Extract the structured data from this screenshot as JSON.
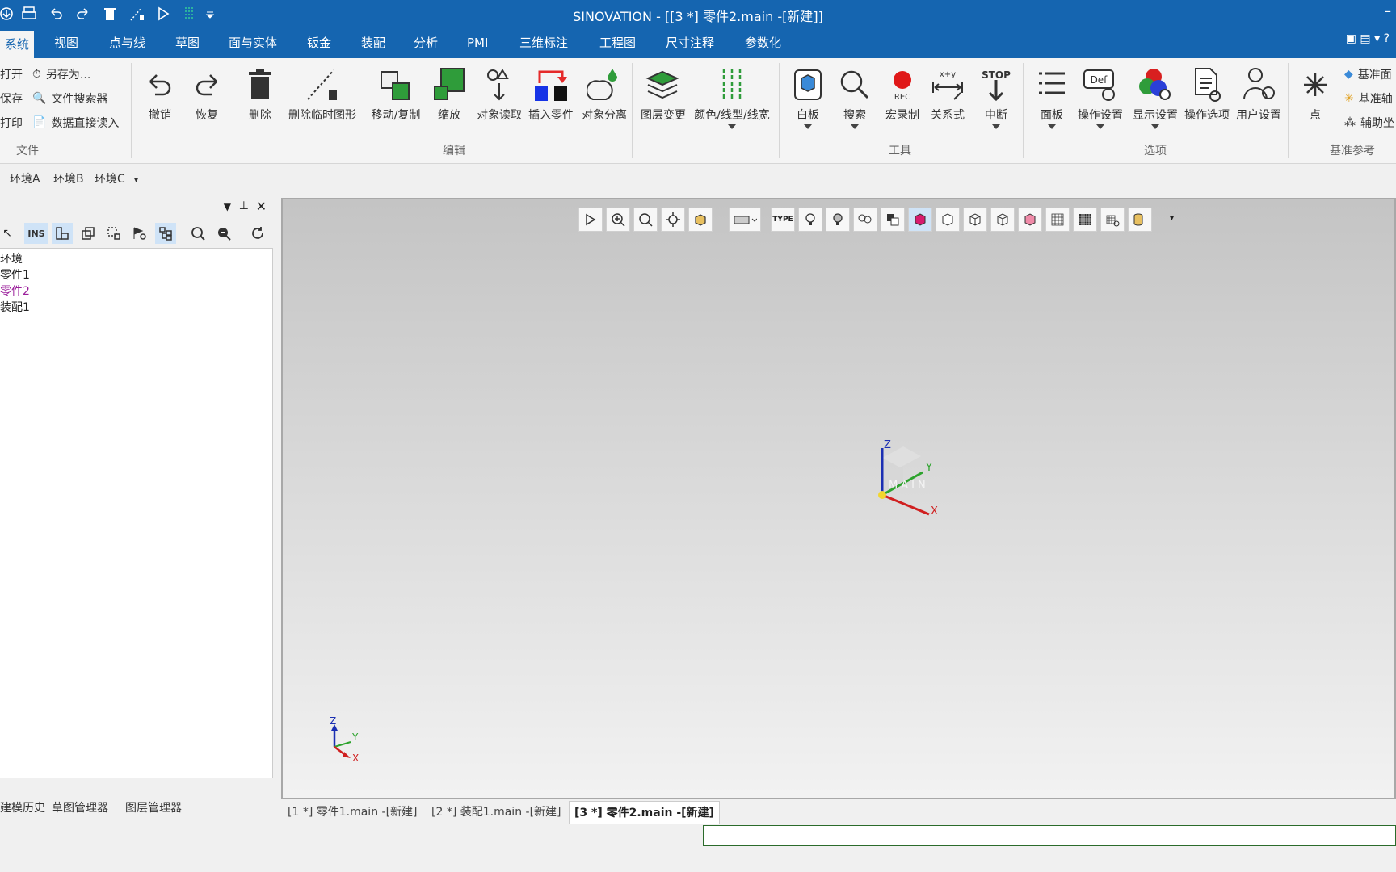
{
  "window": {
    "title": "SINOVATION - [[3 *] 零件2.main -[新建]]"
  },
  "menu": [
    "系统",
    "视图",
    "点与线",
    "草图",
    "面与实体",
    "钣金",
    "装配",
    "分析",
    "PMI",
    "三维标注",
    "工程图",
    "尺寸注释",
    "参数化"
  ],
  "file_group": {
    "open": "打开",
    "save_as": "另存为...",
    "save": "保存",
    "file_search": "文件搜索器",
    "print": "打印",
    "data_import": "数据直接读入",
    "label": "文件"
  },
  "edit_group": {
    "undo": "撤销",
    "redo": "恢复",
    "delete": "删除",
    "delete_temp": "删除临时图形",
    "move_copy": "移动/复制",
    "scale": "缩放",
    "obj_read": "对象读取",
    "insert_part": "插入零件",
    "obj_split": "对象分离",
    "layer_change": "图层变更",
    "color_line": "颜色/线型/线宽",
    "label": "编辑"
  },
  "tools_group": {
    "whiteboard": "白板",
    "search": "搜索",
    "macro": "宏录制",
    "relation": "关系式",
    "interrupt": "中断",
    "label": "工具"
  },
  "options_group": {
    "panel": "面板",
    "op_settings": "操作设置",
    "display_settings": "显示设置",
    "op_options": "操作选项",
    "user_settings": "用户设置",
    "label": "选项"
  },
  "ref_group": {
    "point": "点",
    "datum_plane": "基准面",
    "datum_axis": "基准轴",
    "aux": "辅助坐",
    "label": "基准参考"
  },
  "env_tabs": [
    "环境A",
    "环境B",
    "环境C"
  ],
  "tree": {
    "items": [
      "环境",
      "零件1",
      "零件2",
      "装配1"
    ],
    "active_color": "#9b1f9b"
  },
  "left_bottom_tabs": [
    "建模历史",
    "草图管理器",
    "图层管理器"
  ],
  "doc_tabs": [
    "[1 *] 零件1.main -[新建]",
    "[2 *] 装配1.main -[新建]",
    "[3 *] 零件2.main -[新建]"
  ],
  "viewport": {
    "main_label": "MAIN",
    "axis_z": "Z",
    "axis_y": "Y",
    "axis_x": "X"
  },
  "ins_label": "INS",
  "colors": {
    "brand": "#1565b0",
    "z_axis": "#1b2fb3",
    "y_axis": "#2da32d",
    "x_axis": "#d02020"
  }
}
